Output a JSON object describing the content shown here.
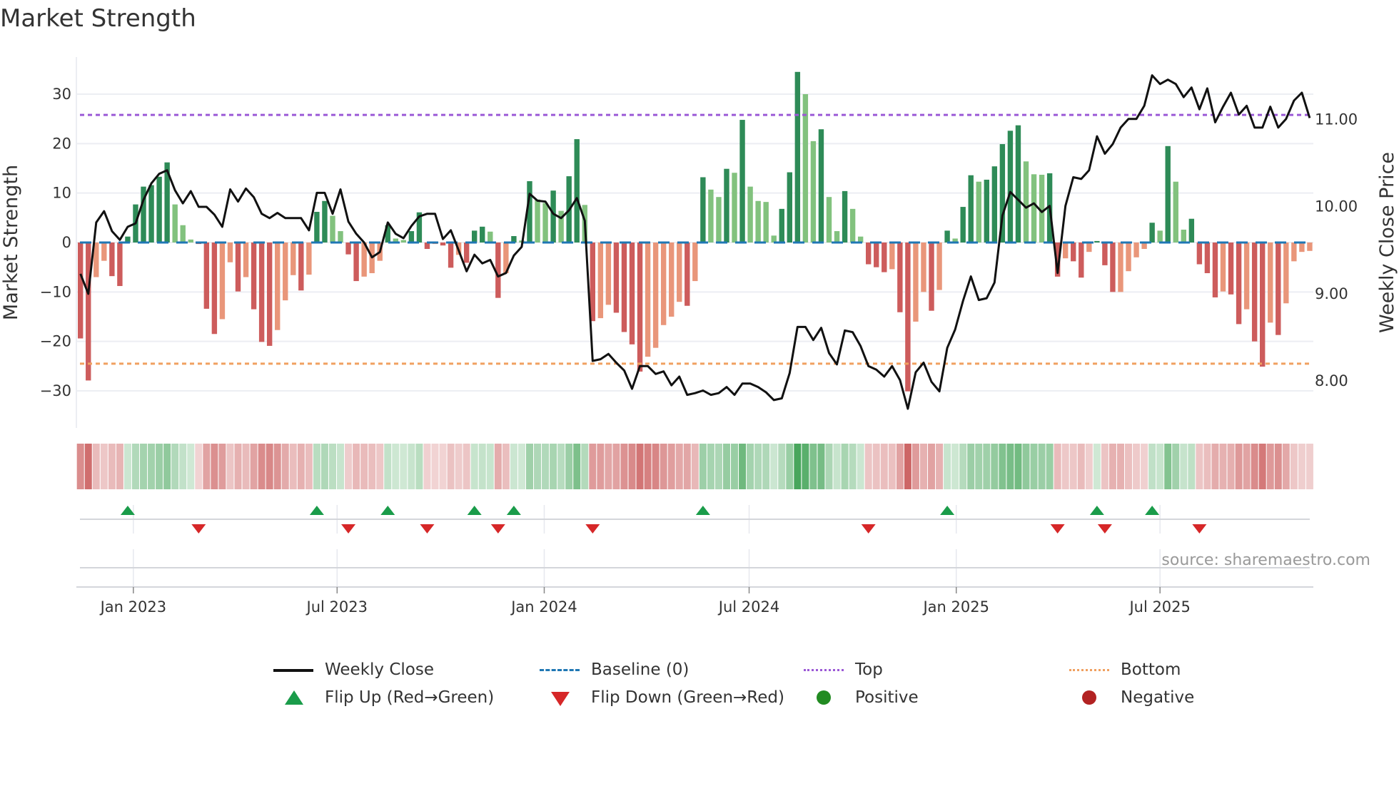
{
  "title": "Market Strength",
  "source": "source: sharemaestro.com",
  "colors": {
    "strong_up": "#2e8b57",
    "weak_up": "#82c27e",
    "strong_down": "#cd5c5c",
    "weak_down": "#e9967a",
    "price": "#111111",
    "baseline": "#1f77b4",
    "top": "#9b59d6",
    "bottom": "#f0a060",
    "flip_up": "#1a9c4a",
    "flip_down": "#d62728",
    "positive": "#228b22",
    "negative": "#b22222"
  },
  "legend": {
    "weekly_close": "Weekly Close",
    "baseline": "Baseline (0)",
    "top": "Top",
    "bottom": "Bottom",
    "flip_up": "Flip Up (Red→Green)",
    "flip_down": "Flip Down (Green→Red)",
    "positive": "Positive",
    "negative": "Negative"
  },
  "chart_data": {
    "type": "bar",
    "title": "Market Strength",
    "ylabel": "Market Strength",
    "y2label": "Weekly Close Price",
    "interval": "weekly",
    "start_date": "2022-11-15",
    "ylim": [
      -37.5,
      37.5
    ],
    "y2lim": [
      7.45,
      11.71
    ],
    "top_level": 25.8,
    "bottom_level": -24.5,
    "baseline": 0,
    "grid": true,
    "legend_position": "bottom",
    "y_ticks": [
      30,
      20,
      10,
      0,
      -10,
      -20,
      -30
    ],
    "y_tick_labels": [
      "30",
      "20",
      "10",
      "0",
      "−10",
      "−20",
      "−30"
    ],
    "y2_ticks": [
      11,
      10,
      9,
      8
    ],
    "y2_tick_labels": [
      "11.00",
      "10.00",
      "9.00",
      "8.00"
    ],
    "x_ticks": [
      {
        "label": "Jan 2023",
        "date": "2023-01-01"
      },
      {
        "label": "Jul 2023",
        "date": "2023-07-01"
      },
      {
        "label": "Jan 2024",
        "date": "2024-01-01"
      },
      {
        "label": "Jul 2024",
        "date": "2024-07-01"
      },
      {
        "label": "Jan 2025",
        "date": "2025-01-01"
      },
      {
        "label": "Jul 2025",
        "date": "2025-07-01"
      }
    ],
    "series": [
      {
        "name": "Market Strength",
        "values": [
          -19.4,
          -27.9,
          -7.0,
          -3.7,
          -6.8,
          -8.8,
          1.2,
          7.7,
          11.3,
          11.6,
          13.3,
          16.2,
          7.7,
          3.5,
          0.6,
          -0.3,
          -13.4,
          -18.5,
          -15.5,
          -4.0,
          -9.9,
          -7.0,
          -13.5,
          -20.1,
          -20.9,
          -17.7,
          -11.7,
          -6.6,
          -9.7,
          -6.5,
          6.2,
          8.4,
          5.4,
          2.3,
          -2.4,
          -7.8,
          -6.9,
          -6.2,
          -3.7,
          3.5,
          0.8,
          0.5,
          2.3,
          6.1,
          -1.3,
          -0.3,
          -0.6,
          -5.1,
          -2.5,
          -4.1,
          2.4,
          3.2,
          2.2,
          -11.2,
          -6.2,
          1.3,
          0.4,
          12.4,
          8.7,
          8.0,
          10.5,
          6.4,
          13.4,
          20.9,
          7.6,
          -15.9,
          -15.3,
          -12.6,
          -14.2,
          -18.1,
          -20.6,
          -26.1,
          -23.1,
          -21.3,
          -16.7,
          -15.0,
          -12.0,
          -12.8,
          -7.8,
          13.2,
          10.7,
          9.2,
          14.9,
          14.1,
          24.8,
          11.3,
          8.4,
          8.2,
          1.4,
          6.8,
          14.2,
          34.5,
          30.0,
          20.5,
          22.9,
          9.2,
          2.3,
          10.4,
          6.8,
          1.2,
          -4.4,
          -5.0,
          -6.0,
          -5.4,
          -14.1,
          -30.1,
          -16.0,
          -10.0,
          -13.8,
          -9.6,
          2.4,
          0.8,
          7.2,
          13.6,
          12.3,
          12.7,
          15.4,
          19.9,
          22.6,
          23.7,
          16.4,
          13.8,
          13.7,
          14.0,
          -6.9,
          -3.2,
          -3.8,
          -7.1,
          -1.9,
          0.3,
          -4.6,
          -10.0,
          -10.0,
          -5.8,
          -3.0,
          -1.3,
          4.0,
          2.4,
          19.5,
          12.3,
          2.6,
          4.8,
          -4.4,
          -6.2,
          -11.1,
          -9.9,
          -10.5,
          -16.5,
          -13.5,
          -20.0,
          -25.1,
          -16.2,
          -18.7,
          -12.3,
          -3.8,
          -1.9,
          -1.7
        ]
      },
      {
        "name": "Weekly Close",
        "axis": "right",
        "values": [
          9.22,
          8.99,
          9.81,
          9.94,
          9.71,
          9.61,
          9.76,
          9.8,
          10.07,
          10.26,
          10.37,
          10.41,
          10.18,
          10.03,
          10.17,
          9.99,
          9.99,
          9.9,
          9.76,
          10.19,
          10.05,
          10.2,
          10.1,
          9.91,
          9.86,
          9.92,
          9.86,
          9.86,
          9.86,
          9.72,
          10.15,
          10.15,
          9.91,
          10.19,
          9.82,
          9.68,
          9.58,
          9.41,
          9.47,
          9.81,
          9.68,
          9.63,
          9.77,
          9.88,
          9.91,
          9.91,
          9.62,
          9.72,
          9.49,
          9.25,
          9.44,
          9.34,
          9.38,
          9.19,
          9.23,
          9.43,
          9.53,
          10.14,
          10.06,
          10.05,
          9.91,
          9.86,
          9.95,
          10.09,
          9.83,
          8.22,
          8.24,
          8.3,
          8.2,
          8.11,
          7.9,
          8.16,
          8.16,
          8.07,
          8.1,
          7.94,
          8.04,
          7.83,
          7.85,
          7.88,
          7.83,
          7.85,
          7.92,
          7.83,
          7.96,
          7.96,
          7.92,
          7.86,
          7.77,
          7.79,
          8.08,
          8.61,
          8.61,
          8.46,
          8.6,
          8.31,
          8.18,
          8.57,
          8.55,
          8.39,
          8.16,
          8.12,
          8.04,
          8.16,
          8.0,
          7.67,
          8.09,
          8.2,
          7.98,
          7.87,
          8.37,
          8.58,
          8.91,
          9.19,
          8.92,
          8.94,
          9.12,
          9.89,
          10.16,
          10.07,
          9.98,
          10.03,
          9.93,
          10.0,
          9.23,
          10.0,
          10.33,
          10.31,
          10.41,
          10.8,
          10.6,
          10.71,
          10.9,
          11.0,
          11.0,
          11.15,
          11.5,
          11.4,
          11.45,
          11.4,
          11.25,
          11.36,
          11.11,
          11.35,
          10.96,
          11.14,
          11.3,
          11.05,
          11.15,
          10.9,
          10.9,
          11.14,
          10.9,
          11.0,
          11.21,
          11.3,
          11.01
        ]
      }
    ],
    "flip_up_weeks": [
      7,
      31,
      40,
      51,
      56,
      80,
      111,
      130,
      137
    ],
    "flip_down_weeks": [
      16,
      35,
      45,
      54,
      66,
      101,
      125,
      131,
      143
    ]
  }
}
